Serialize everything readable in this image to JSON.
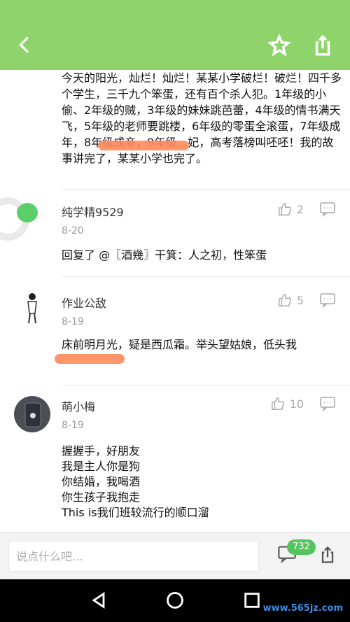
{
  "header": {
    "back_icon": "back-icon",
    "star_icon": "star-icon",
    "share_icon": "share-icon"
  },
  "post": {
    "first_text": "今天的阳光，灿烂！灿烂！某某小学破烂！破烂！四千多个学生，三千九个笨蛋，还有百个杀人犯。1年级的小偷、2年级的贼，3年级的妹妹跳芭蕾，4年级的情书满天飞，5年级的老师要跳楼，6年级的零蛋全滚蛋，7年级成年，8年级成亲，9年级…妃，高考落榜叫呸呸！我的故事讲完了，某某小学也完了。"
  },
  "comments": [
    {
      "name": "纯学精9529",
      "date": "8-20",
      "likes": "2",
      "text": "回复了 @〖酒幾〗干箕：人之初，性笨蛋"
    },
    {
      "name": "作业公敌",
      "date": "8-19",
      "likes": "5",
      "text": "床前明月光，疑是西瓜霜。举头望姑娘，低头我"
    },
    {
      "name": "萌小梅",
      "date": "8-19",
      "likes": "10",
      "text_lines": [
        "握握手，好朋友",
        "我是主人你是狗",
        "你结婚，我喝酒",
        "你生孩子我抱走",
        "This is我们班较流行的顺口溜"
      ]
    }
  ],
  "bottom": {
    "input_placeholder": "说点什么吧...",
    "comment_count": "732"
  },
  "watermark": "www.565jz.com",
  "colors": {
    "header_green": "#8fd46a",
    "badge_green": "#54c45e",
    "scribble": "#ff8a5b"
  }
}
